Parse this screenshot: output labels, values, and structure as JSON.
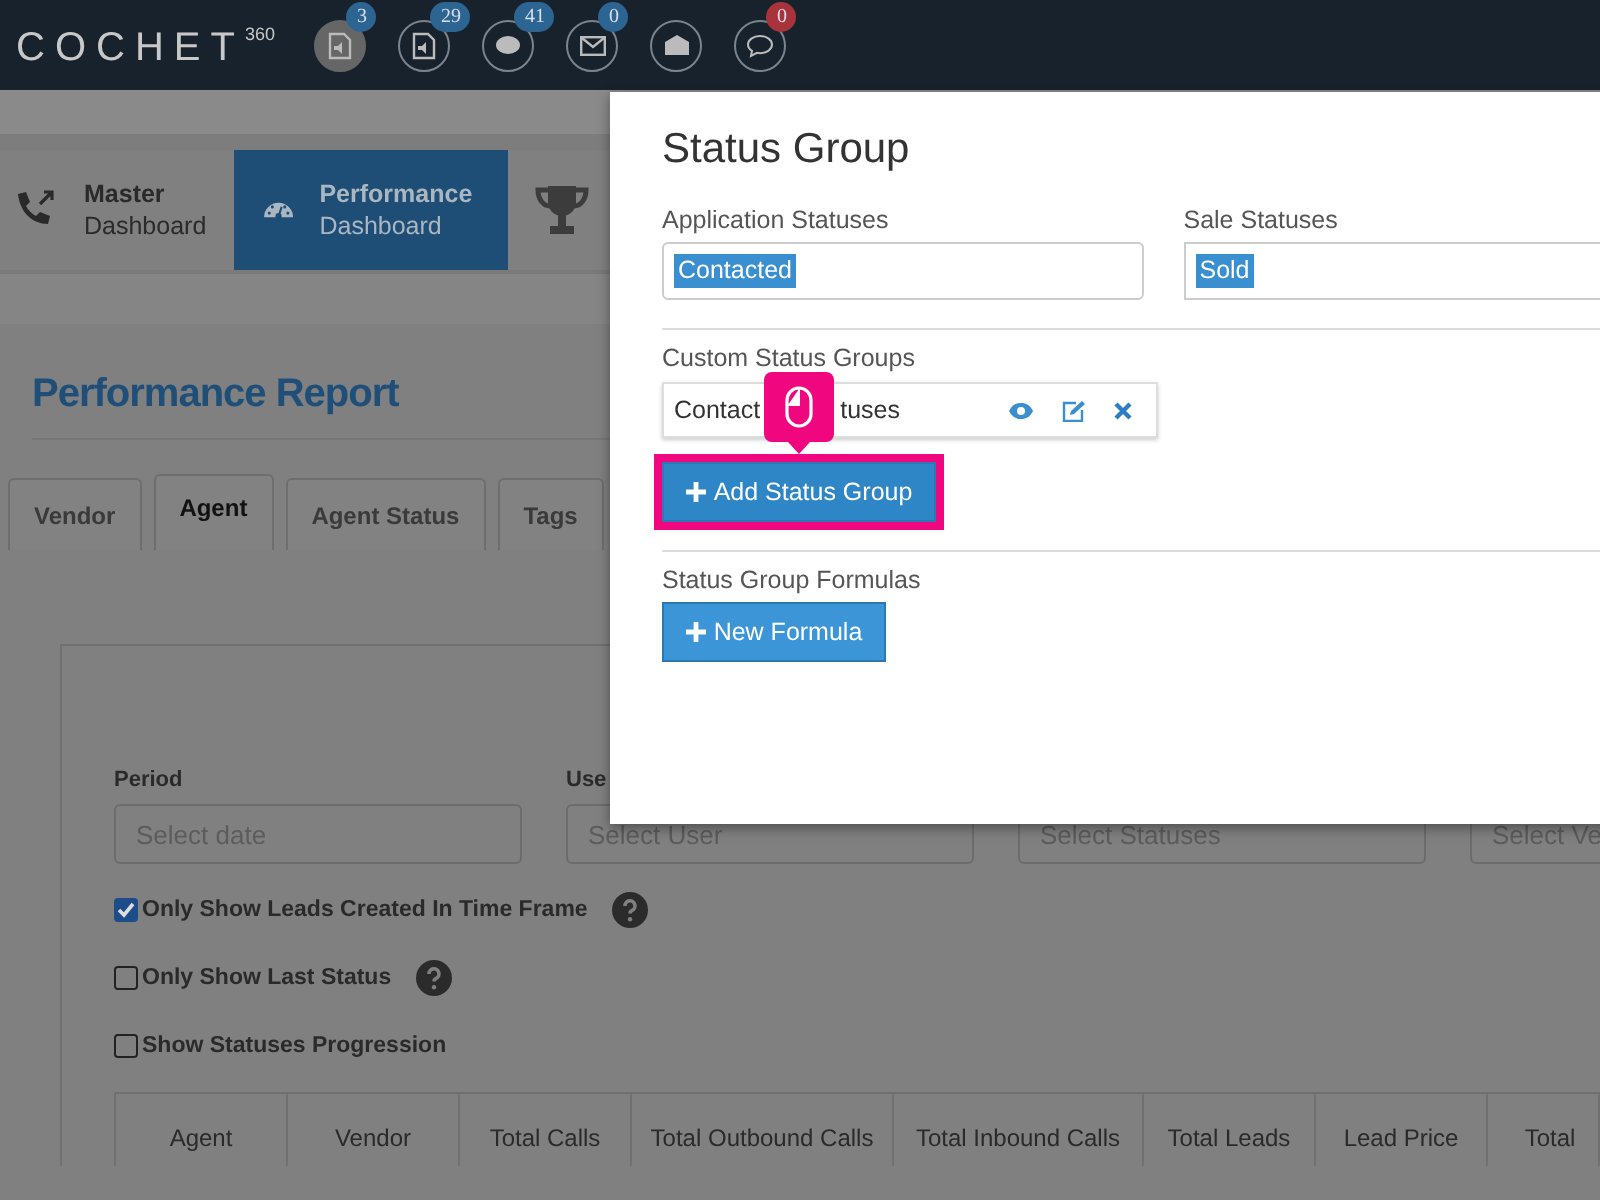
{
  "logo": "COCHET$^{360}$",
  "notifications": [
    {
      "badge": "3",
      "selected": true,
      "color": "#2c6592"
    },
    {
      "badge": "29",
      "selected": false,
      "color": "#2c6592"
    },
    {
      "badge": "41",
      "selected": false,
      "color": "#2c6592"
    },
    {
      "badge": "0",
      "selected": false,
      "color": "#2c6592"
    },
    {
      "selected": false
    },
    {
      "badge": "0",
      "selected": false,
      "color": "#a8333a"
    }
  ],
  "nav": [
    {
      "title": "Master",
      "subtitle": "Dashboard",
      "selected": false
    },
    {
      "title": "Performance",
      "subtitle": "Dashboard",
      "selected": true
    }
  ],
  "page_title": "Performance Report",
  "tabs": [
    {
      "label": "Vendor",
      "selected": false
    },
    {
      "label": "Agent",
      "selected": true
    },
    {
      "label": "Agent Status",
      "selected": false
    },
    {
      "label": "Tags",
      "selected": false
    }
  ],
  "filters": [
    {
      "label": "Period",
      "placeholder": "Select date"
    },
    {
      "label": "Use",
      "placeholder": "Select User"
    },
    {
      "placeholder": "Select Statuses"
    },
    {
      "placeholder": "Select Ve"
    }
  ],
  "options": [
    {
      "label": "Only Show Leads Created In Time Frame",
      "checked": true,
      "help": true
    },
    {
      "label": "Only Show Last Status",
      "checked": false,
      "help": true
    },
    {
      "label": "Show Statuses Progression",
      "checked": false
    }
  ],
  "table": {
    "columns": [
      "Agent",
      "Vendor",
      "Total Calls",
      "Total Outbound Calls",
      "Total Inbound Calls",
      "Total Leads",
      "Lead Price",
      "Total"
    ]
  },
  "modal": {
    "title": "Status Group",
    "fields": [
      {
        "label": "Application Statuses",
        "tags": [
          "Contacted"
        ]
      },
      {
        "label": "Sale Statuses",
        "tags": [
          "Sold"
        ]
      }
    ],
    "custom_label": "Custom Status Groups",
    "groups": [
      {
        "name_parts": [
          "Contact",
          "tuses"
        ]
      }
    ],
    "add_button": "Add Status Group",
    "formulas_label": "Status Group Formulas",
    "formula_button": "New Formula"
  }
}
